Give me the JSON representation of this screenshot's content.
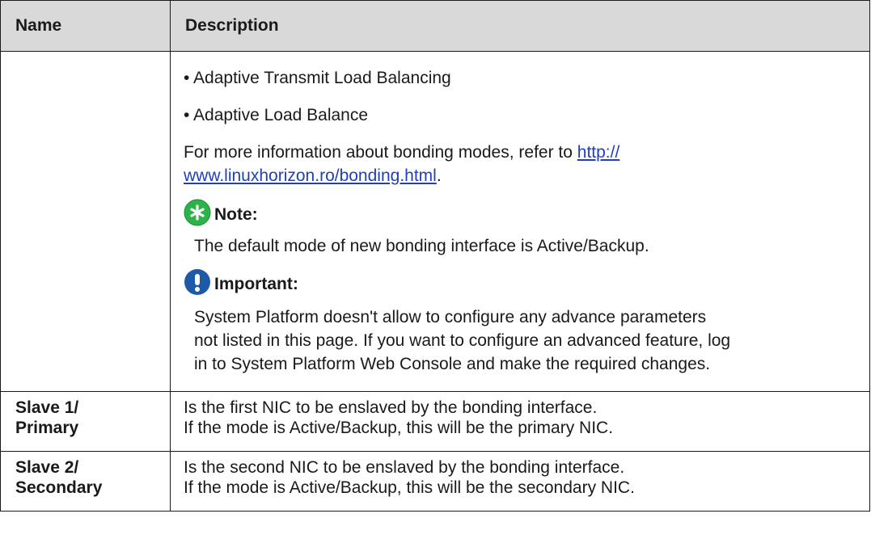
{
  "table": {
    "headers": {
      "name": "Name",
      "description": "Description"
    },
    "mode_row": {
      "name": "",
      "bullets": [
        "• Adaptive Transmit Load Balancing",
        "• Adaptive Load Balance"
      ],
      "info": {
        "prefix": "For more information about bonding modes, refer to ",
        "link_line1": "http://",
        "link_line2": "www.linuxhorizon.ro/bonding.html",
        "suffix": "."
      },
      "note": {
        "icon": "note-star-icon",
        "icon_color": "#2db24a",
        "label": "Note:",
        "text": "The default mode of new bonding interface is Active/Backup."
      },
      "important": {
        "icon": "exclamation-icon",
        "icon_color": "#1e5aa8",
        "label": "Important:",
        "lines": [
          "System Platform doesn't allow to configure any advance parameters",
          "not listed in this page. If you want to configure an advanced feature, log",
          "in to System Platform Web Console and make the required changes."
        ]
      }
    },
    "slave_rows": [
      {
        "name_line1": "Slave 1/",
        "name_line2": "Primary",
        "desc_line1": "Is the first NIC to be enslaved by the bonding interface.",
        "desc_line2": "If the mode is Active/Backup, this will be the primary NIC."
      },
      {
        "name_line1": "Slave 2/",
        "name_line2": "Secondary",
        "desc_line1": "Is the second NIC to be enslaved by the bonding interface.",
        "desc_line2": "If the mode is Active/Backup, this will be the secondary NIC."
      }
    ]
  }
}
